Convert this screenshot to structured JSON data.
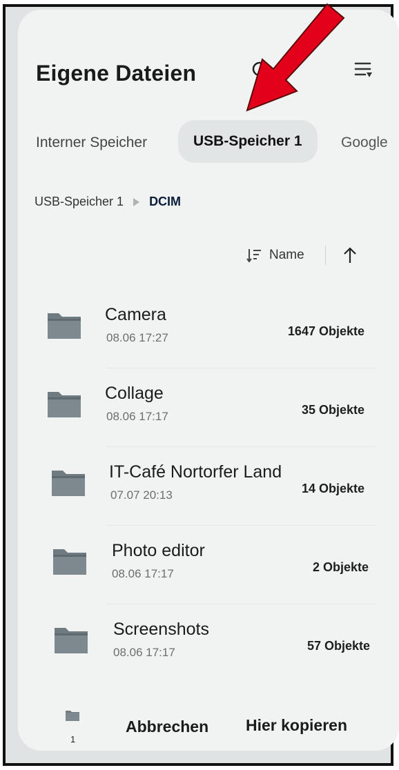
{
  "header": {
    "title": "Eigene Dateien",
    "search_icon": "search-icon",
    "menu_icon": "list-menu-icon"
  },
  "tabs": [
    {
      "label": "Interner Speicher",
      "active": false
    },
    {
      "label": "USB-Speicher 1",
      "active": true
    },
    {
      "label": "Google",
      "active": false
    }
  ],
  "breadcrumb": {
    "parent": "USB-Speicher 1",
    "current": "DCIM"
  },
  "sort": {
    "label": "Name",
    "direction": "ascending"
  },
  "folders": [
    {
      "name": "Camera",
      "date": "08.06 17:27",
      "count": "1647 Objekte"
    },
    {
      "name": "Collage",
      "date": "08.06 17:17",
      "count": "35 Objekte"
    },
    {
      "name": "IT-Café Nortorfer Land",
      "date": "07.07 20:13",
      "count": "14 Objekte"
    },
    {
      "name": "Photo editor",
      "date": "08.06 17:17",
      "count": "2 Objekte"
    },
    {
      "name": "Screenshots",
      "date": "08.06 17:17",
      "count": "57 Objekte"
    }
  ],
  "bottom_bar": {
    "selected_count": "1",
    "cancel_label": "Abbrechen",
    "copy_label": "Hier kopieren"
  },
  "colors": {
    "background": "#f1f3f3",
    "active_tab": "#e2e5e6",
    "folder": "#6f7b80",
    "annotation_arrow": "#e3001b"
  }
}
